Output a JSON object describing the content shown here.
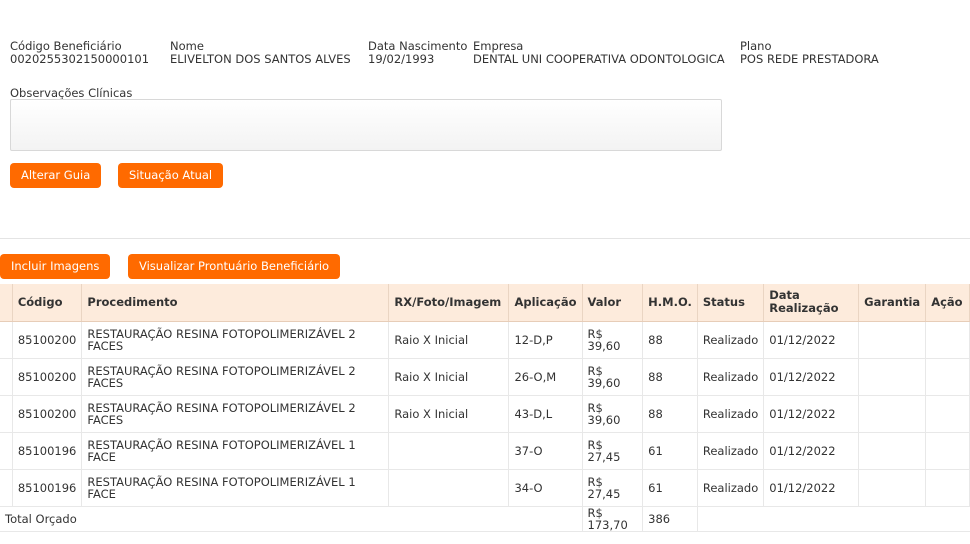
{
  "beneficiario": {
    "codigo_label": "Código Beneficiário",
    "codigo_value": "0020255302150000101",
    "nome_label": "Nome",
    "nome_value": "ELIVELTON DOS SANTOS ALVES",
    "nascimento_label": "Data Nascimento",
    "nascimento_value": "19/02/1993",
    "empresa_label": "Empresa",
    "empresa_value": "DENTAL UNI COOPERATIVA ODONTOLOGICA",
    "plano_label": "Plano",
    "plano_value": "POS REDE PRESTADORA"
  },
  "observacoes": {
    "label": "Observações Clínicas",
    "value": ""
  },
  "buttons": {
    "alterar_guia": "Alterar Guia",
    "situacao_atual": "Situação Atual",
    "incluir_imagens": "Incluir Imagens",
    "visualizar_prontuario": "Visualizar Prontuário Beneficiário"
  },
  "table": {
    "headers": [
      "Código",
      "Procedimento",
      "RX/Foto/Imagem",
      "Aplicação",
      "Valor",
      "H.M.O.",
      "Status",
      "Data Realização",
      "Garantia",
      "Ação"
    ],
    "rows": [
      {
        "codigo": "85100200",
        "procedimento": "RESTAURAÇÃO RESINA FOTOPOLIMERIZÁVEL 2 FACES",
        "rx": "Raio X Inicial",
        "aplicacao": "12-D,P",
        "valor": "R$ 39,60",
        "hmo": "88",
        "status": "Realizado",
        "data": "01/12/2022",
        "garantia": "",
        "acao": ""
      },
      {
        "codigo": "85100200",
        "procedimento": "RESTAURAÇÃO RESINA FOTOPOLIMERIZÁVEL 2 FACES",
        "rx": "Raio X Inicial",
        "aplicacao": "26-O,M",
        "valor": "R$ 39,60",
        "hmo": "88",
        "status": "Realizado",
        "data": "01/12/2022",
        "garantia": "",
        "acao": ""
      },
      {
        "codigo": "85100200",
        "procedimento": "RESTAURAÇÃO RESINA FOTOPOLIMERIZÁVEL 2 FACES",
        "rx": "Raio X Inicial",
        "aplicacao": "43-D,L",
        "valor": "R$ 39,60",
        "hmo": "88",
        "status": "Realizado",
        "data": "01/12/2022",
        "garantia": "",
        "acao": ""
      },
      {
        "codigo": "85100196",
        "procedimento": "RESTAURAÇÃO RESINA FOTOPOLIMERIZÁVEL 1 FACE",
        "rx": "",
        "aplicacao": "37-O",
        "valor": "R$ 27,45",
        "hmo": "61",
        "status": "Realizado",
        "data": "01/12/2022",
        "garantia": "",
        "acao": ""
      },
      {
        "codigo": "85100196",
        "procedimento": "RESTAURAÇÃO RESINA FOTOPOLIMERIZÁVEL 1 FACE",
        "rx": "",
        "aplicacao": "34-O",
        "valor": "R$ 27,45",
        "hmo": "61",
        "status": "Realizado",
        "data": "01/12/2022",
        "garantia": "",
        "acao": ""
      }
    ],
    "total": {
      "label": "Total Orçado",
      "valor": "R$ 173,70",
      "hmo": "386"
    }
  }
}
